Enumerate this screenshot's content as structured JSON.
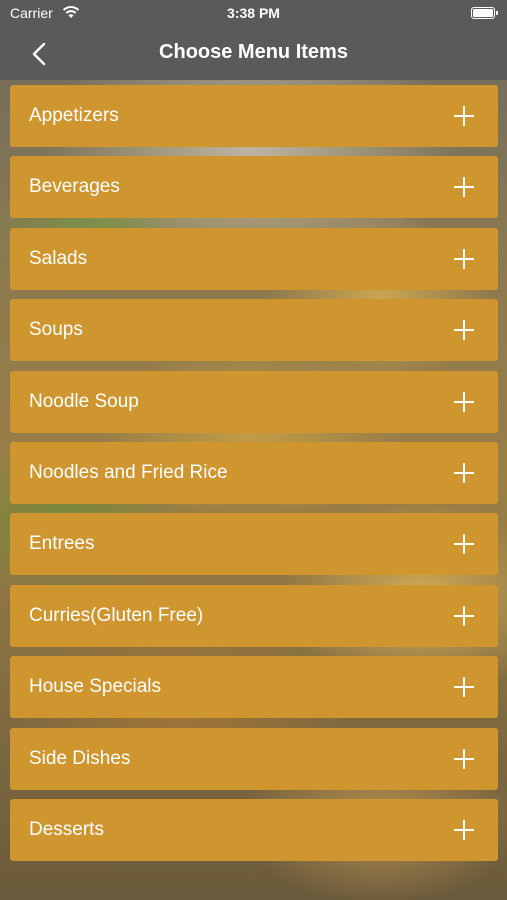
{
  "status_bar": {
    "carrier": "Carrier",
    "time": "3:38 PM",
    "wifi_icon": "wifi-icon",
    "battery_icon": "battery-icon"
  },
  "nav": {
    "title": "Choose Menu Items",
    "back_icon": "chevron-left-icon"
  },
  "menu": {
    "accent_color": "#cf952f",
    "expand_icon": "plus-icon",
    "items": [
      {
        "label": "Appetizers"
      },
      {
        "label": "Beverages"
      },
      {
        "label": "Salads"
      },
      {
        "label": "Soups"
      },
      {
        "label": "Noodle Soup"
      },
      {
        "label": "Noodles and Fried Rice"
      },
      {
        "label": "Entrees"
      },
      {
        "label": "Curries(Gluten Free)"
      },
      {
        "label": "House Specials"
      },
      {
        "label": "Side Dishes"
      },
      {
        "label": "Desserts"
      }
    ]
  }
}
